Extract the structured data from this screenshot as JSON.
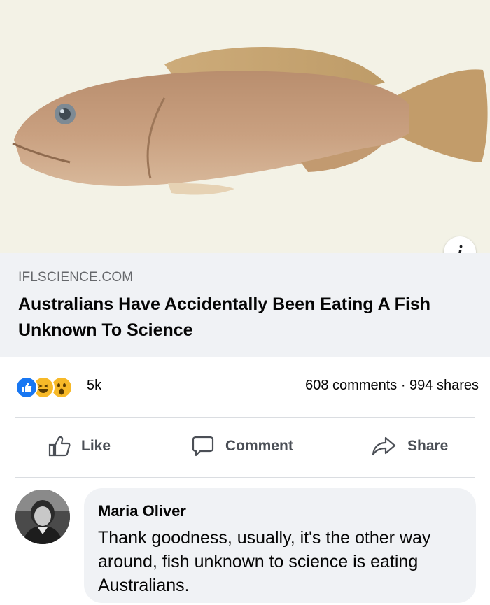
{
  "post": {
    "link": {
      "domain": "IFLSCIENCE.COM",
      "headline": "Australians Have Accidentally Been Eating A Fish Unknown To Science",
      "image_alt": "fish"
    },
    "info_icon": "info-icon",
    "stats": {
      "reactions_icons": [
        "like-icon",
        "haha-icon",
        "wow-icon"
      ],
      "reaction_count": "5k",
      "counts_text": "608 comments · 994 shares"
    },
    "actions": {
      "like": "Like",
      "comment": "Comment",
      "share": "Share"
    },
    "comment": {
      "author": "Maria Oliver",
      "text": "Thank goodness, usually, it's the other way around, fish unknown to science is eating Australians."
    }
  },
  "colors": {
    "image_bg": "#f3f2e6",
    "link_bg": "#f0f2f5",
    "like_blue": "#1877f2",
    "reaction_yellow": "#f7b928"
  }
}
